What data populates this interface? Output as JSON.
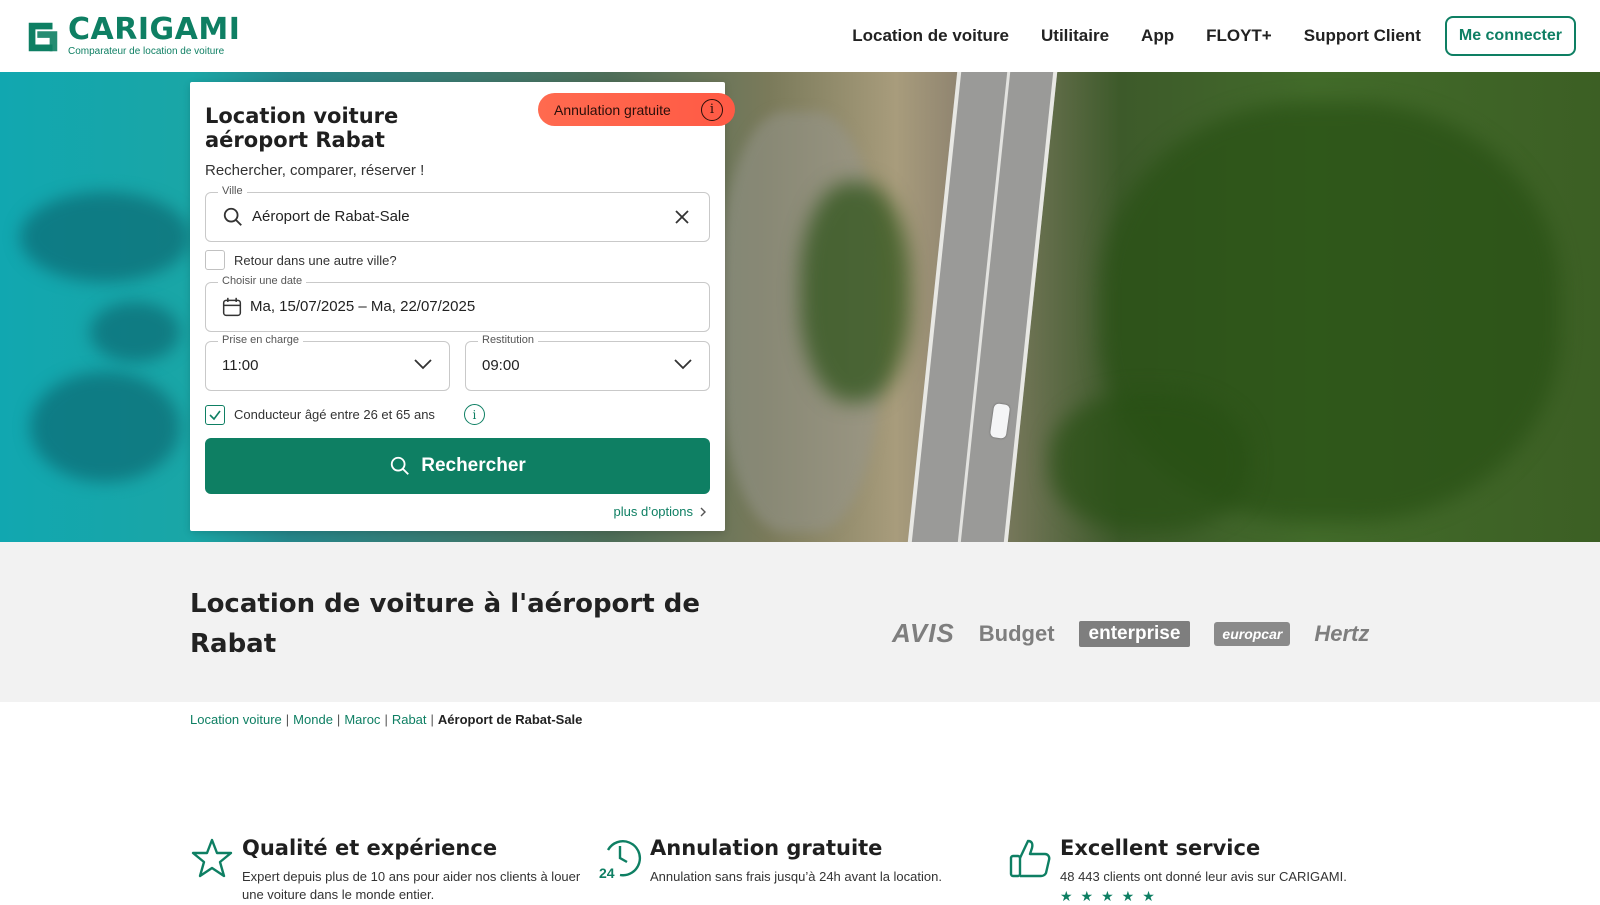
{
  "brand": {
    "name": "CARIGAMI",
    "tagline": "Comparateur de location de voiture",
    "accent_color": "#0e7f63"
  },
  "nav": {
    "items": [
      "Location de voiture",
      "Utilitaire",
      "App",
      "FLOYT+",
      "Support Client"
    ],
    "login_label": "Me connecter"
  },
  "search_card": {
    "title": "Location voiture aéroport Rabat",
    "subtitle": "Rechercher, comparer, réserver !",
    "badge": "Annulation gratuite",
    "city": {
      "label": "Ville",
      "value": "Aéroport de Rabat-Sale",
      "icon": "search-icon"
    },
    "return_other_city": {
      "label": "Retour dans une autre ville?",
      "checked": false
    },
    "dates": {
      "label": "Choisir une date",
      "value": "Ma, 15/07/2025 – Ma, 22/07/2025",
      "icon": "calendar-icon"
    },
    "pickup": {
      "label": "Prise en charge",
      "value": "11:00"
    },
    "return": {
      "label": "Restitution",
      "value": "09:00"
    },
    "driver_age": {
      "label": "Conducteur âgé entre 26 et 65 ans",
      "checked": true
    },
    "search_button": "Rechercher",
    "more_options": "plus d’options"
  },
  "section": {
    "title": "Location de voiture à l'aéroport de Rabat",
    "brands": [
      "AVIS",
      "Budget",
      "enterprise",
      "europcar",
      "Hertz"
    ]
  },
  "breadcrumb": {
    "links": [
      "Location voiture",
      "Monde",
      "Maroc",
      "Rabat"
    ],
    "current": "Aéroport de Rabat-Sale",
    "separator": "|"
  },
  "features": [
    {
      "title": "Qualité et expérience",
      "text": "Expert depuis plus de 10 ans pour aider nos clients à louer une voiture dans le monde entier.",
      "icon": "star-icon"
    },
    {
      "title": "Annulation gratuite",
      "text": "Annulation sans frais jusqu’à 24h avant la location.",
      "icon": "clock-24-icon",
      "icon_text": "24"
    },
    {
      "title": "Excellent service",
      "text": "48 443 clients ont donné leur avis sur CARIGAMI.",
      "icon": "thumbs-up-icon",
      "rating": 5
    }
  ]
}
